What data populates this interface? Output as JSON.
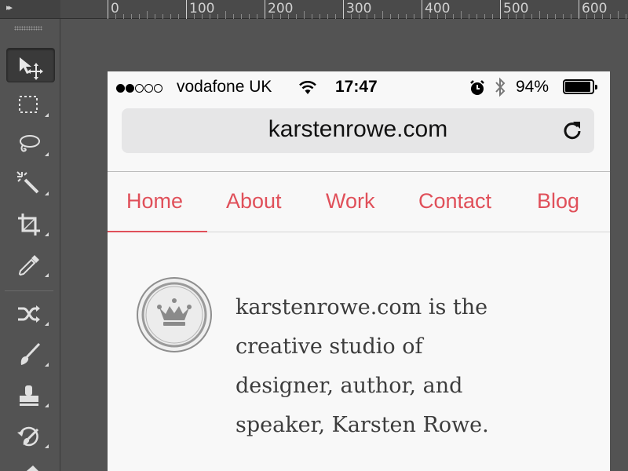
{
  "ruler": {
    "labels": [
      "0",
      "100",
      "200",
      "300",
      "400",
      "500",
      "600"
    ]
  },
  "toolbar": {
    "tools": [
      {
        "name": "move-tool",
        "icon": "move-icon",
        "active": true
      },
      {
        "name": "marquee-tool",
        "icon": "marquee-icon"
      },
      {
        "name": "lasso-tool",
        "icon": "lasso-icon"
      },
      {
        "name": "magic-wand-tool",
        "icon": "magic-wand-icon"
      },
      {
        "name": "crop-tool",
        "icon": "crop-icon"
      },
      {
        "name": "eyedropper-tool",
        "icon": "eyedropper-icon"
      },
      {
        "name": "healing-tool",
        "icon": "healing-icon"
      },
      {
        "name": "brush-tool",
        "icon": "brush-icon"
      },
      {
        "name": "stamp-tool",
        "icon": "stamp-icon"
      },
      {
        "name": "history-brush-tool",
        "icon": "history-brush-icon"
      }
    ]
  },
  "status_bar": {
    "carrier": "vodafone UK",
    "time": "17:47",
    "battery": "94%",
    "battery_level": 0.94,
    "signal_bars_filled": 2,
    "signal_bars_total": 5
  },
  "browser": {
    "url": "karstenrowe.com"
  },
  "nav": {
    "items": [
      "Home",
      "About",
      "Work",
      "Contact",
      "Blog"
    ],
    "active": "Home",
    "color": "#e0505a"
  },
  "content": {
    "intro_lines": [
      "karstenrowe.com is the",
      "creative studio of",
      "designer, author, and",
      "speaker, Karsten Rowe."
    ],
    "logo_icon": "crown-icon"
  }
}
